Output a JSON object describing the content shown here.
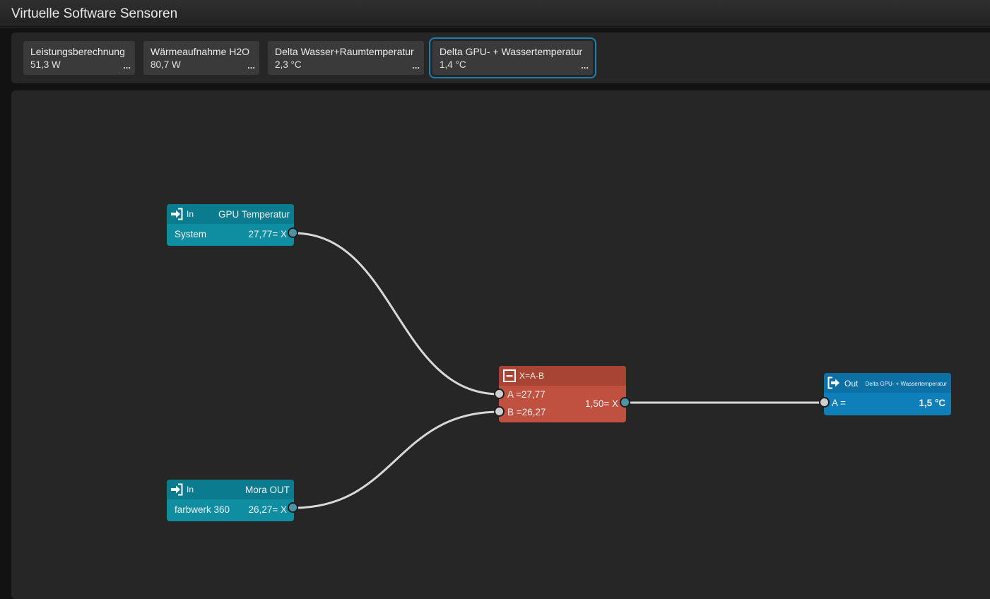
{
  "window": {
    "title": "Virtuelle Software Sensoren"
  },
  "sensor_cards": [
    {
      "name": "Leistungsberechnung",
      "value": "51,3 W",
      "more": "...",
      "active": false
    },
    {
      "name": "Wärmeaufnahme H2O",
      "value": "80,7 W",
      "more": "...",
      "active": false
    },
    {
      "name": "Delta Wasser+Raumtemperatur",
      "value": "2,3 °C",
      "more": "...",
      "active": false
    },
    {
      "name": "Delta GPU- + Wassertemperatur",
      "value": "1,4 °C",
      "more": "...",
      "active": true
    }
  ],
  "nodes": {
    "input_gpu": {
      "kind": "In",
      "name": "GPU Temperatur",
      "source": "System",
      "value": "27,77=",
      "port": "X"
    },
    "input_mora": {
      "kind": "In",
      "name": "Mora OUT",
      "source": "farbwerk 360",
      "value": "26,27=",
      "port": "X"
    },
    "subtract": {
      "formula": "X=A-B",
      "input_a": "A =27,77",
      "input_b": "B =26,27",
      "result": "1,50=",
      "port": "X"
    },
    "output": {
      "kind": "Out",
      "name": "Delta GPU- + Wassertemperatur",
      "input_a": "A =",
      "value": "1,5 °C"
    }
  },
  "colors": {
    "input_node": "#0f8ea2",
    "calc_node": "#c05040",
    "output_node": "#0f7fb9",
    "active_outline": "#1e7fb0",
    "wire": "#d8d8d8"
  },
  "icons": {
    "input_node": "sign-in-icon",
    "calc_node": "minus-square-icon",
    "output_node": "sign-out-icon"
  }
}
